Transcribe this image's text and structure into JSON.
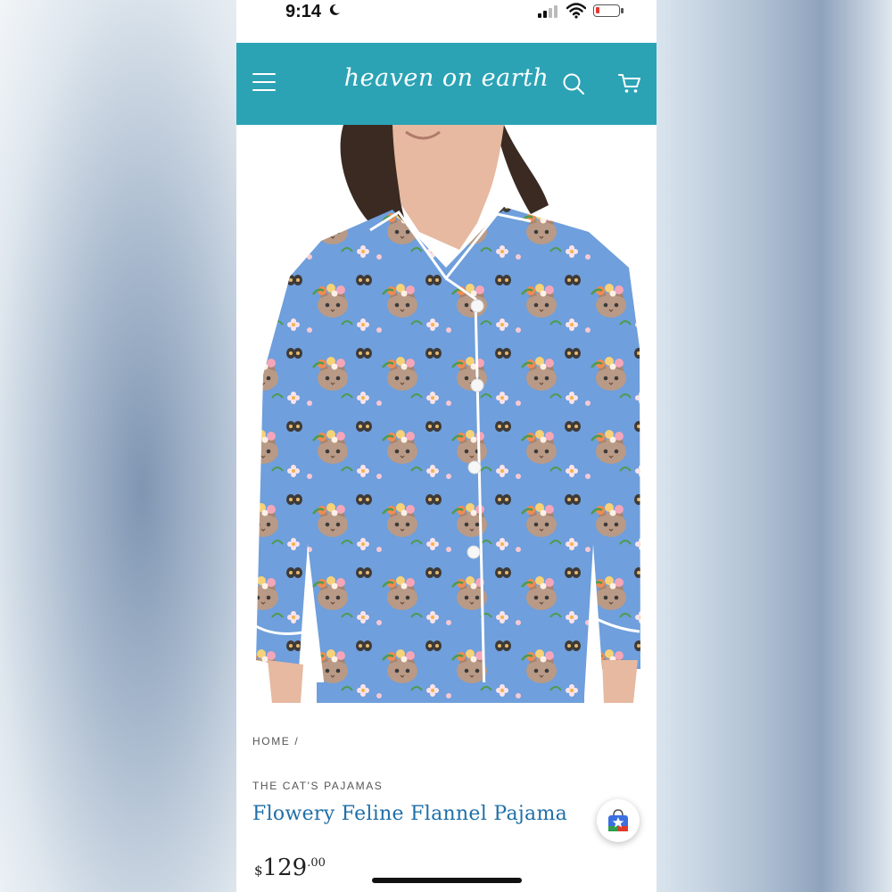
{
  "status_bar": {
    "time": "9:14"
  },
  "header": {
    "logo": "heaven on earth",
    "colors": {
      "background": "#2ba3b5",
      "icons": "#ffffff"
    }
  },
  "icons": [
    "menu-icon",
    "search-icon",
    "cart-icon",
    "moon-icon",
    "wifi-icon",
    "battery-icon",
    "shop-app-icon"
  ],
  "breadcrumb": {
    "label": "HOME /"
  },
  "product": {
    "vendor": "THE CAT'S PAJAMAS",
    "title": "Flowery Feline Flannel Pajama",
    "price": {
      "currency": "$",
      "amount": "129",
      "cents": ".00"
    },
    "colors": {
      "title": "#1f6fa8",
      "fabric": "#6f9fdc"
    }
  }
}
